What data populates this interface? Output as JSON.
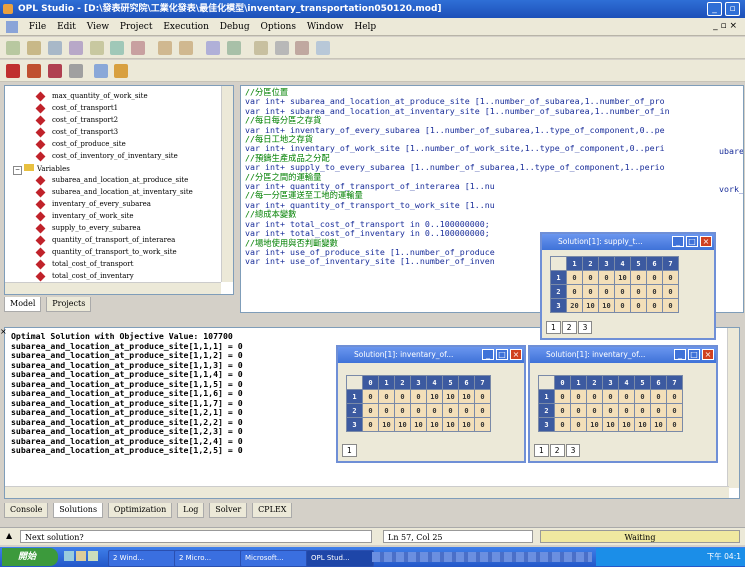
{
  "window_title": "OPL Studio - [D:\\發表研究院\\工業化發表\\最佳化模型\\inventary_transportation050120.mod]",
  "menu": [
    "File",
    "Edit",
    "View",
    "Project",
    "Execution",
    "Debug",
    "Options",
    "Window",
    "Help"
  ],
  "tree": {
    "items": [
      "max_quantity_of_work_site",
      "cost_of_transport1",
      "cost_of_transport2",
      "cost_of_transport3",
      "cost_of_produce_site",
      "cost_of_inventory_of_inventary_site"
    ],
    "folder_label": "Variables",
    "var_items": [
      "subarea_and_location_at_produce_site",
      "subarea_and_location_at_inventary_site",
      "inventary_of_every_subarea",
      "inventary_of_work_site",
      "supply_to_every_subarea",
      "quantity_of_transport_of_interarea",
      "quantity_of_transport_to_work_site",
      "total_cost_of_transport",
      "total_cost_of_inventary"
    ],
    "tab_model": "Model",
    "tab_projects": "Projects"
  },
  "code_lines": [
    {
      "t": "//分區位置",
      "k": "comment"
    },
    {
      "t": "var int+ subarea_and_location_at_produce_site [1..number_of_subarea,1..number_of_pro",
      "k": "blue"
    },
    {
      "t": "var int+ subarea_and_location_at_inventary_site [1..number_of_subarea,1..number_of_in",
      "k": "blue"
    },
    {
      "t": "//每日每分區之存貨",
      "k": "comment"
    },
    {
      "t": "var int+ inventary_of_every_subarea [1..number_of_subarea,1..type_of_component,0..pe",
      "k": "blue"
    },
    {
      "t": "//每日工地之存貨",
      "k": "comment"
    },
    {
      "t": "var int+ inventary_of_work_site [1..number_of_work_site,1..type_of_component,0..peri",
      "k": "blue"
    },
    {
      "t": "//預鑄生產成品之分配",
      "k": "comment"
    },
    {
      "t": "var int+ supply_to_every_subarea [1..number_of_subarea,1..type_of_component,1..perio",
      "k": "blue"
    },
    {
      "t": "//分區之間的運輸量",
      "k": "comment"
    },
    {
      "t": "var int+ quantity_of_transport_of_interarea [1..nu",
      "k": "blue"
    },
    {
      "t": "//每一分區運送至工地的運輸量",
      "k": "comment"
    },
    {
      "t": "var int+ quantity_of_transport_to_work_site [1..nu",
      "k": "blue"
    },
    {
      "t": "//總成本變數",
      "k": "comment"
    },
    {
      "t": "var int+ total_cost_of_transport in 0..100000000;",
      "k": "blue"
    },
    {
      "t": "var int+ total_cost_of_inventary in 0..100000000;",
      "k": "blue"
    },
    {
      "t": "//場地使用與否判斷變數",
      "k": "comment"
    },
    {
      "t": "var int+ use_of_produce_site [1..number_of_produce",
      "k": "blue"
    },
    {
      "t": "var int+ use_of_inventary_site [1..number_of_inven",
      "k": "blue"
    }
  ],
  "code_tail": {
    "line1": "ubare",
    "line5": "vork_s"
  },
  "output_lines": [
    "Optimal Solution with Objective Value: 107700",
    "subarea_and_location_at_produce_site[1,1,1] = 0",
    "subarea_and_location_at_produce_site[1,1,2] = 0",
    "subarea_and_location_at_produce_site[1,1,3] = 0",
    "subarea_and_location_at_produce_site[1,1,4] = 0",
    "subarea_and_location_at_produce_site[1,1,5] = 0",
    "subarea_and_location_at_produce_site[1,1,6] = 0",
    "subarea_and_location_at_produce_site[1,1,7] = 0",
    "subarea_and_location_at_produce_site[1,2,1] = 0",
    "subarea_and_location_at_produce_site[1,2,2] = 0",
    "subarea_and_location_at_produce_site[1,2,3] = 0",
    "subarea_and_location_at_produce_site[1,2,4] = 0",
    "subarea_and_location_at_produce_site[1,2,5] = 0"
  ],
  "win_supply": {
    "title": "Solution[1]: supply_t...",
    "cols": [
      "1",
      "2",
      "3",
      "4",
      "5",
      "6",
      "7"
    ],
    "rows": [
      {
        "h": "1",
        "v": [
          "0",
          "0",
          "0",
          "10",
          "0",
          "0",
          "0"
        ]
      },
      {
        "h": "2",
        "v": [
          "0",
          "0",
          "0",
          "0",
          "0",
          "0",
          "0"
        ]
      },
      {
        "h": "3",
        "v": [
          "20",
          "10",
          "10",
          "0",
          "0",
          "0",
          "0"
        ]
      }
    ],
    "tabs": [
      "1",
      "2",
      "3"
    ]
  },
  "win_inv1": {
    "title": "Solution[1]: inventary_of...",
    "cols": [
      "0",
      "1",
      "2",
      "3",
      "4",
      "5",
      "6",
      "7"
    ],
    "rows": [
      {
        "h": "1",
        "v": [
          "0",
          "0",
          "0",
          "0",
          "10",
          "10",
          "10",
          "0"
        ]
      },
      {
        "h": "2",
        "v": [
          "0",
          "0",
          "0",
          "0",
          "0",
          "0",
          "0",
          "0"
        ]
      },
      {
        "h": "3",
        "v": [
          "0",
          "10",
          "10",
          "10",
          "10",
          "10",
          "10",
          "0"
        ]
      }
    ],
    "tabs": [
      "1"
    ]
  },
  "win_inv2": {
    "title": "Solution[1]: inventary_of...",
    "cols": [
      "0",
      "1",
      "2",
      "3",
      "4",
      "5",
      "6",
      "7"
    ],
    "rows": [
      {
        "h": "1",
        "v": [
          "0",
          "0",
          "0",
          "0",
          "0",
          "0",
          "0",
          "0"
        ]
      },
      {
        "h": "2",
        "v": [
          "0",
          "0",
          "0",
          "0",
          "0",
          "0",
          "0",
          "0"
        ]
      },
      {
        "h": "3",
        "v": [
          "0",
          "0",
          "10",
          "10",
          "10",
          "10",
          "10",
          "0"
        ]
      }
    ],
    "tabs": [
      "1",
      "2",
      "3"
    ]
  },
  "bottom_tabs": [
    "Console",
    "Solutions",
    "Optimization",
    "Log",
    "Solver",
    "CPLEX"
  ],
  "status": {
    "message": "Next solution?",
    "position": "Ln 57, Col 25",
    "state": "Waiting"
  },
  "taskbar": {
    "start": "開始",
    "items": [
      "2 Wind...",
      "2 Micro...",
      "Microsoft...",
      "OPL Stud..."
    ],
    "clock": "下午 04:1"
  }
}
